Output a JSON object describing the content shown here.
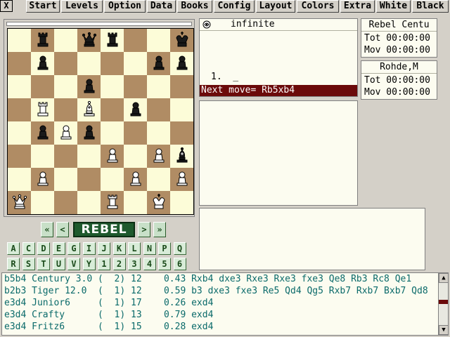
{
  "menu": {
    "close": "X",
    "items": [
      "Start",
      "Levels",
      "Option",
      "Data",
      "Books",
      "Config",
      "Layout",
      "Colors",
      "Extra",
      "White",
      "Black"
    ]
  },
  "board": {
    "rows": [
      [
        "",
        "bR",
        "",
        "bQ",
        "bR",
        "",
        "",
        "bK"
      ],
      [
        "",
        "bP",
        "",
        "",
        "",
        "",
        "bP",
        "bP"
      ],
      [
        "",
        "",
        "",
        "bP",
        "",
        "",
        "",
        ""
      ],
      [
        "",
        "wR",
        "",
        "wB",
        "",
        "bP",
        "",
        ""
      ],
      [
        "",
        "bP",
        "wP",
        "bP",
        "",
        "",
        "",
        ""
      ],
      [
        "",
        "",
        "",
        "",
        "wP",
        "",
        "wP",
        "bB"
      ],
      [
        "",
        "wP",
        "",
        "",
        "",
        "wP",
        "",
        "wP"
      ],
      [
        "wQ",
        "",
        "",
        "",
        "wR",
        "",
        "wK",
        ""
      ]
    ],
    "light_color": "#fcfcd8",
    "dark_color": "#b08c64"
  },
  "controls": {
    "first": "«",
    "back": "<",
    "logo": "REBEL",
    "forward": ">",
    "last": "»"
  },
  "keys_row1": [
    "A",
    "C",
    "D",
    "E",
    "G",
    "I",
    "J",
    "K",
    "L",
    "N",
    "P",
    "Q"
  ],
  "keys_row2": [
    "R",
    "S",
    "T",
    "U",
    "V",
    "Y",
    "1",
    "2",
    "3",
    "4",
    "5",
    "6"
  ],
  "notation": {
    "mode": "infinite",
    "move_line": "1.  _",
    "next_move": "Next move= Rb5xb4"
  },
  "clocks": [
    {
      "name": "Rebel Centu",
      "tot": "Tot 00:00:00",
      "mov": "Mov 00:00:00"
    },
    {
      "name": "Rohde,M",
      "tot": "Tot 00:00:00",
      "mov": "Mov 00:00:00"
    }
  ],
  "engines": [
    "b5b4 Century 3.0 (  2) 12    0.43 Rxb4 dxe3 Rxe3 Rxe3 fxe3 Qe8 Rb3 Rc8 Qe1",
    "b2b3 Tiger 12.0  (  1) 12    0.59 b3 dxe3 fxe3 Re5 Qd4 Qg5 Rxb7 Rxb7 Bxb7 Qd8",
    "e3d4 Junior6     (  1) 17    0.26 exd4",
    "e3d4 Crafty      (  1) 13    0.79 exd4",
    "e3d4 Fritz6      (  1) 15    0.28 exd4"
  ],
  "colors": {
    "accent_dark_red": "#6b0a0a",
    "engine_text": "#0a6a6a",
    "logo_green": "#1f5a2e"
  }
}
